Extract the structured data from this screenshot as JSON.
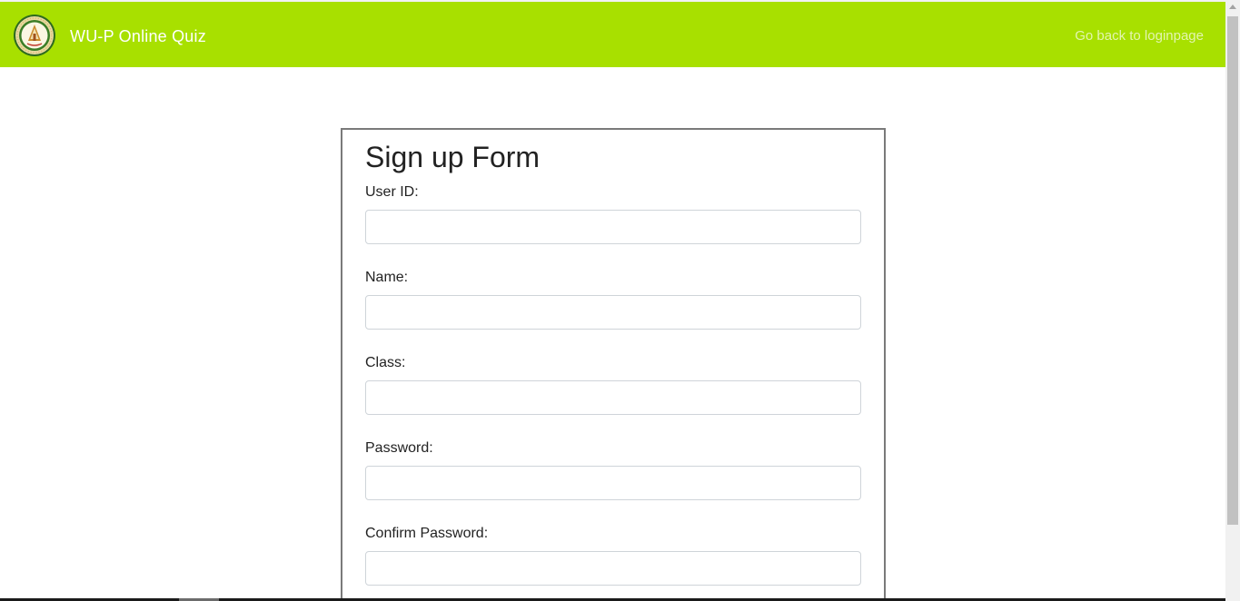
{
  "header": {
    "brand": "WU-P Online Quiz",
    "back_link": "Go back to loginpage",
    "logo_icon": "university-seal-logo",
    "bg_color": "#a8e000"
  },
  "form": {
    "title": "Sign up Form",
    "fields": [
      {
        "label": "User ID:",
        "value": "",
        "placeholder": ""
      },
      {
        "label": "Name:",
        "value": "",
        "placeholder": ""
      },
      {
        "label": "Class:",
        "value": "",
        "placeholder": ""
      },
      {
        "label": "Password:",
        "value": "",
        "placeholder": ""
      },
      {
        "label": "Confirm Password:",
        "value": "",
        "placeholder": ""
      }
    ]
  }
}
